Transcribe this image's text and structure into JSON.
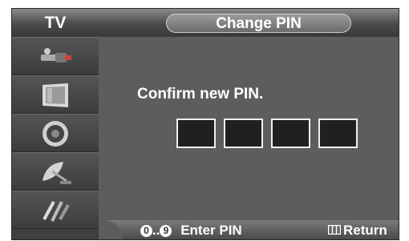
{
  "header": {
    "left_title": "TV",
    "screen_title": "Change PIN"
  },
  "sidebar": {
    "items": [
      {
        "icon": "input-connector-icon"
      },
      {
        "icon": "picture-monitor-icon"
      },
      {
        "icon": "speaker-icon"
      },
      {
        "icon": "satellite-dish-icon"
      },
      {
        "icon": "setup-tools-icon"
      }
    ]
  },
  "main": {
    "prompt": "Confirm new PIN.",
    "pin_slots": 4
  },
  "footer": {
    "key_start": "0",
    "key_separator": "..",
    "key_end": "9",
    "enter_label": "Enter PIN",
    "return_label": "Return"
  },
  "colors": {
    "panel": "#5d5d5d",
    "header": "#4a4a4a",
    "pin_box_fill": "#202020",
    "pin_box_border": "#f0f0f0",
    "text": "#ffffff"
  }
}
